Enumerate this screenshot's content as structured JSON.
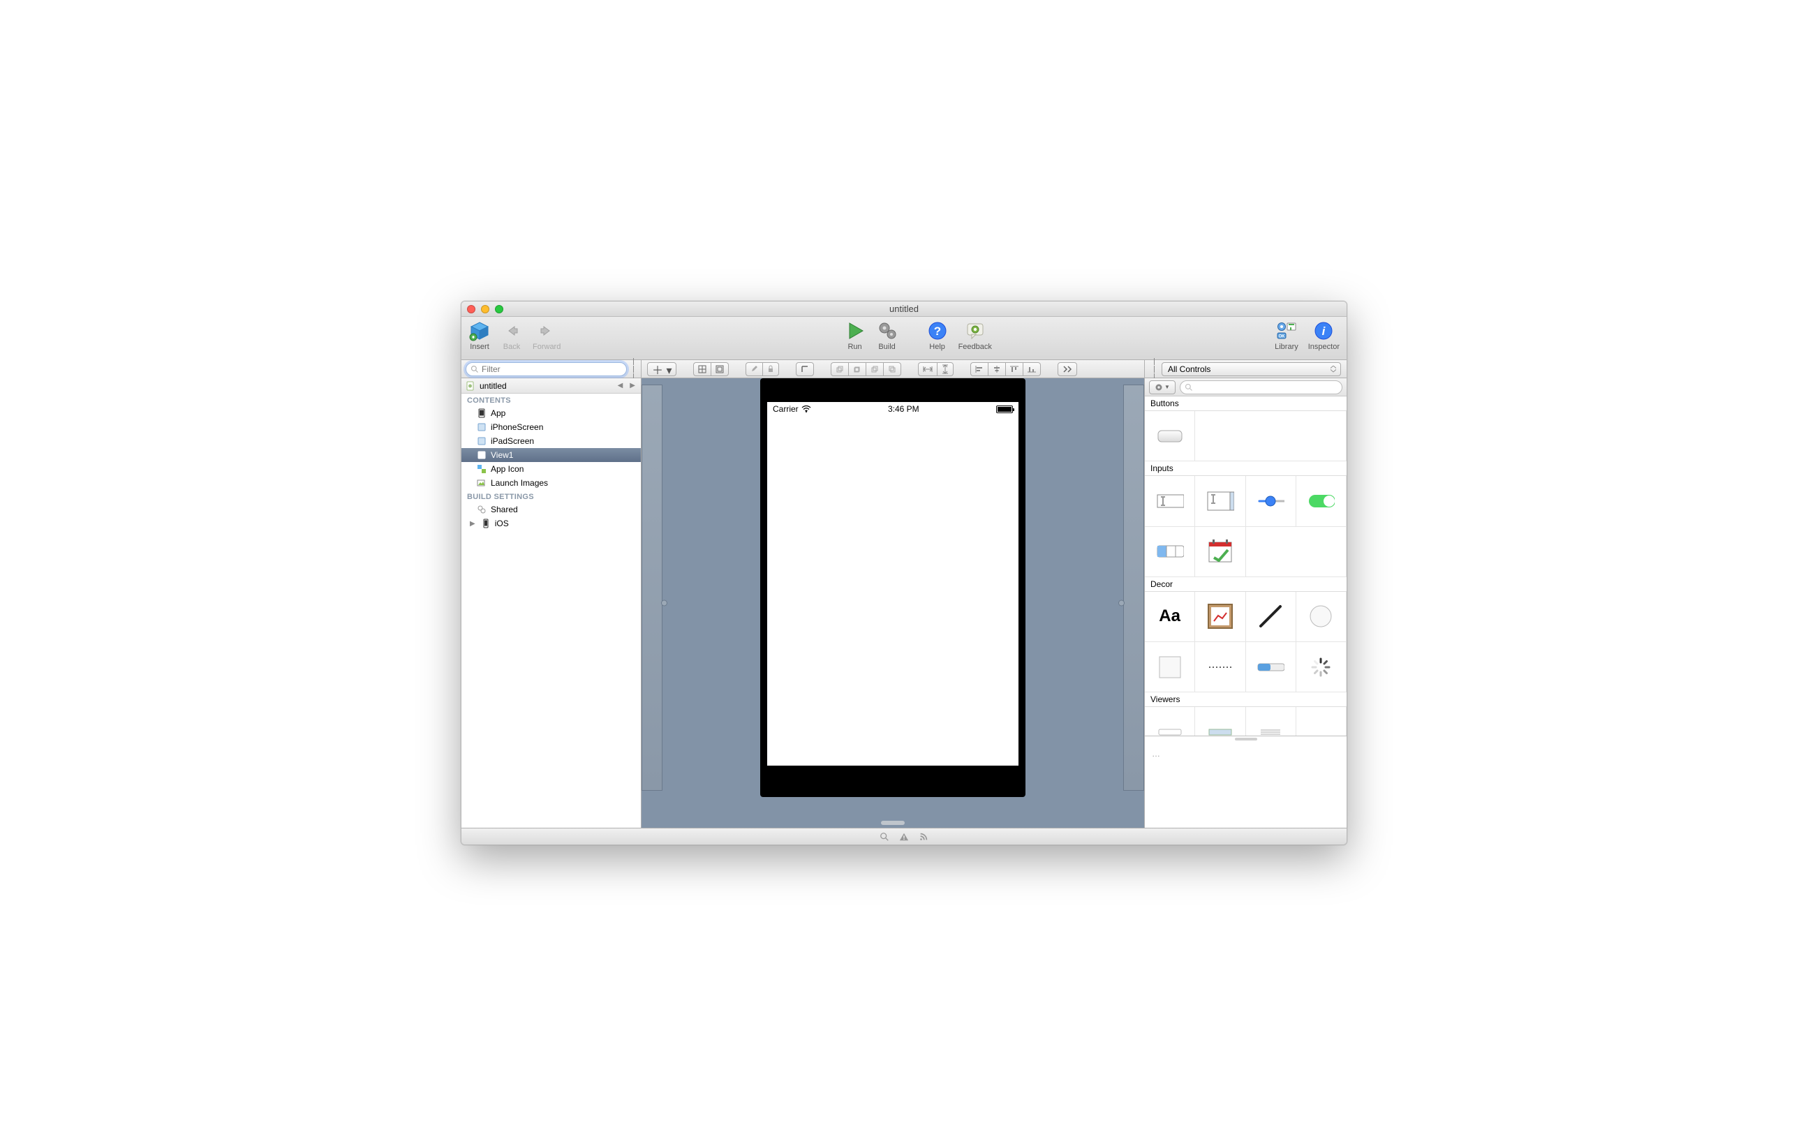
{
  "window": {
    "title": "untitled"
  },
  "toolbar": {
    "insert": "Insert",
    "back": "Back",
    "forward": "Forward",
    "run": "Run",
    "build": "Build",
    "help": "Help",
    "feedback": "Feedback",
    "library": "Library",
    "inspector": "Inspector"
  },
  "sidebar": {
    "filter_placeholder": "Filter",
    "project_name": "untitled",
    "sections": {
      "contents": "CONTENTS",
      "build": "BUILD SETTINGS"
    },
    "contents_items": [
      {
        "label": "App"
      },
      {
        "label": "iPhoneScreen"
      },
      {
        "label": "iPadScreen"
      },
      {
        "label": "View1",
        "selected": true
      },
      {
        "label": "App Icon"
      },
      {
        "label": "Launch Images"
      }
    ],
    "build_items": [
      {
        "label": "Shared"
      },
      {
        "label": "iOS",
        "expandable": true
      }
    ]
  },
  "canvas": {
    "statusbar": {
      "carrier": "Carrier",
      "time": "3:46 PM"
    }
  },
  "inspector": {
    "filter_selected": "All Controls",
    "sections": {
      "buttons": "Buttons",
      "inputs": "Inputs",
      "decor": "Decor",
      "viewers": "Viewers"
    },
    "desc_placeholder": "…"
  }
}
